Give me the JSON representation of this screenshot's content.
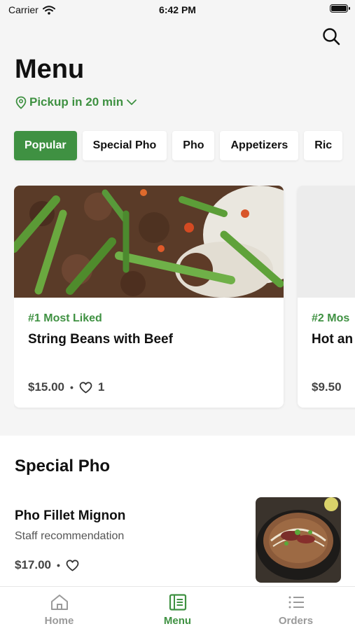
{
  "status_bar": {
    "carrier": "Carrier",
    "time": "6:42 PM"
  },
  "header": {
    "title": "Menu",
    "pickup": "Pickup in 20 min"
  },
  "categories": [
    "Popular",
    "Special Pho",
    "Pho",
    "Appetizers",
    "Ric"
  ],
  "featured": [
    {
      "tag": "#1 Most Liked",
      "name": "String Beans with Beef",
      "price": "$15.00",
      "likes": "1"
    },
    {
      "tag": "#2 Mos",
      "name": "Hot an",
      "price": "$9.50"
    }
  ],
  "special_pho": {
    "title": "Special Pho",
    "items": [
      {
        "name": "Pho Fillet Mignon",
        "description": "Staff recommendation",
        "price": "$17.00"
      }
    ]
  },
  "tabs": [
    {
      "label": "Home",
      "icon": "home-icon"
    },
    {
      "label": "Menu",
      "icon": "menu-book-icon"
    },
    {
      "label": "Orders",
      "icon": "list-icon"
    }
  ],
  "colors": {
    "accent": "#3f9142",
    "background": "#f5f5f5"
  }
}
